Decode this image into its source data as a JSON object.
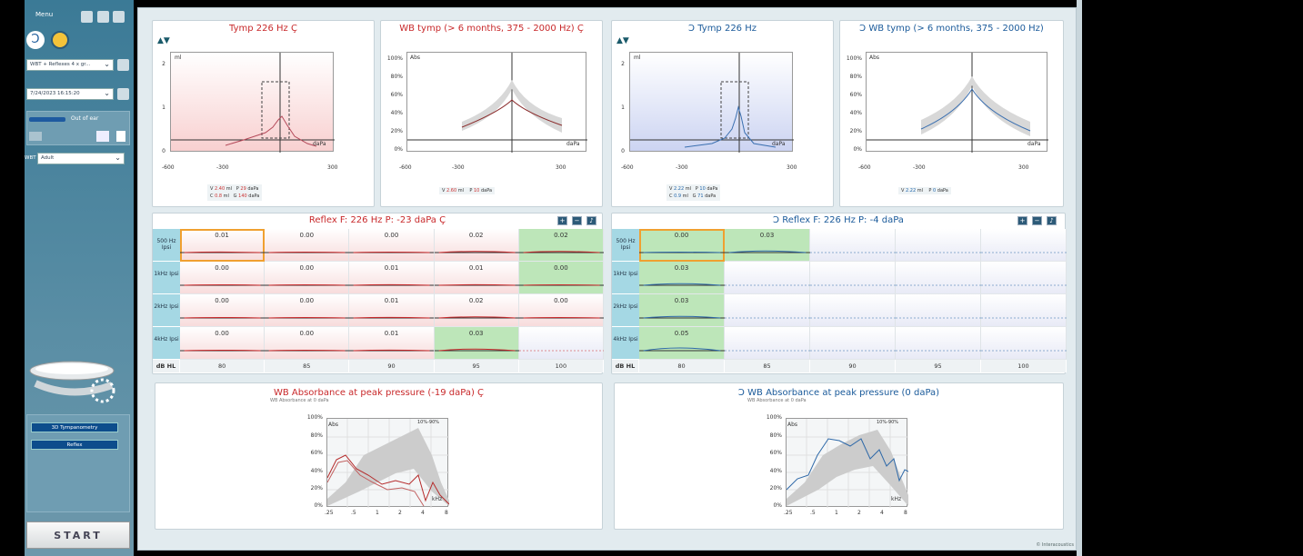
{
  "sidebar": {
    "menu_label": "Menu",
    "protocol": "WBT + Reflexes 4 x gr...",
    "session_date": "7/24/2023 16:15:20",
    "probe_status": "Out of ear",
    "wbt_label": "WBT",
    "wbt_mode": "Adult",
    "tests": [
      {
        "label": "3D Tympanometry"
      },
      {
        "label": "Reflex"
      }
    ],
    "start_label": "START"
  },
  "tymp_left": {
    "title": "Tymp 226 Hz",
    "y_unit": "ml",
    "y_ticks": [
      "2",
      "1",
      "0"
    ],
    "x_unit": "daPa",
    "x_ticks": [
      "-600",
      "-300",
      "300"
    ],
    "vals": {
      "v": "2.40",
      "v_unit": "ml",
      "p": "29",
      "p_unit": "daPa",
      "c": "0.8",
      "c_unit": "ml",
      "g": "140",
      "g_unit": "daPa"
    }
  },
  "wb_left": {
    "title": "WB tymp (> 6 months, 375 - 2000 Hz)",
    "y_unit": "Abs",
    "y_ticks": [
      "100%",
      "80%",
      "60%",
      "40%",
      "20%",
      "0%"
    ],
    "x_unit": "daPa",
    "x_ticks": [
      "-600",
      "-300",
      "300"
    ],
    "vals": {
      "v": "2.60",
      "v_unit": "ml",
      "p": "10",
      "p_unit": "daPa"
    }
  },
  "tymp_right": {
    "title": "Tymp 226 Hz",
    "y_unit": "ml",
    "y_ticks": [
      "2",
      "1",
      "0"
    ],
    "x_unit": "daPa",
    "x_ticks": [
      "-600",
      "-300",
      "300"
    ],
    "vals": {
      "v": "2.22",
      "v_unit": "ml",
      "p": "10",
      "p_unit": "daPa",
      "c": "0.9",
      "c_unit": "ml",
      "g": "71",
      "g_unit": "daPa"
    }
  },
  "wb_right": {
    "title": "WB tymp (> 6 months, 375 - 2000 Hz)",
    "y_unit": "Abs",
    "y_ticks": [
      "100%",
      "80%",
      "60%",
      "40%",
      "20%",
      "0%"
    ],
    "x_unit": "daPa",
    "x_ticks": [
      "-600",
      "-300",
      "300"
    ],
    "vals": {
      "v": "2.22",
      "v_unit": "ml",
      "p": "0",
      "p_unit": "daPa"
    }
  },
  "reflex_left": {
    "title": "Reflex  F: 226 Hz P: -23 daPa",
    "rows": [
      "500 Hz Ipsi",
      "1kHz Ipsi",
      "2kHz Ipsi",
      "4kHz Ipsi"
    ],
    "values": [
      [
        "0.01",
        "0.00",
        "0.00",
        "0.02",
        "0.02"
      ],
      [
        "0.00",
        "0.00",
        "0.01",
        "0.01",
        "0.00"
      ],
      [
        "0.00",
        "0.00",
        "0.01",
        "0.02",
        "0.00"
      ],
      [
        "0.00",
        "0.00",
        "0.01",
        "0.03",
        ""
      ]
    ],
    "unit": "dB HL",
    "levels": [
      "80",
      "85",
      "90",
      "95",
      "100"
    ]
  },
  "reflex_right": {
    "title": "Reflex  F: 226 Hz P: -4 daPa",
    "rows": [
      "500 Hz Ipsi",
      "1kHz Ipsi",
      "2kHz Ipsi",
      "4kHz Ipsi"
    ],
    "values": [
      [
        "0.00",
        "0.03",
        "",
        "",
        ""
      ],
      [
        "0.03",
        "",
        "",
        "",
        ""
      ],
      [
        "0.03",
        "",
        "",
        "",
        ""
      ],
      [
        "0.05",
        "",
        "",
        "",
        ""
      ]
    ],
    "unit": "dB HL",
    "levels": [
      "80",
      "85",
      "90",
      "95",
      "100"
    ]
  },
  "abs_left": {
    "title": "WB Absorbance at peak pressure (-19 daPa)",
    "subtitle": "WB Absorbance at 0 daPa",
    "y_unit": "Abs",
    "y_ticks": [
      "100%",
      "80%",
      "60%",
      "40%",
      "20%",
      "0%"
    ],
    "x_ticks": [
      ".25",
      ".5",
      "1",
      "2",
      "4",
      "8"
    ],
    "x_unit": "kHz",
    "norm": "10%-90%"
  },
  "abs_right": {
    "title": "WB Absorbance at peak pressure (0 daPa)",
    "subtitle": "WB Absorbance at 0 daPa",
    "y_unit": "Abs",
    "y_ticks": [
      "100%",
      "80%",
      "60%",
      "40%",
      "20%",
      "0%"
    ],
    "x_ticks": [
      ".25",
      ".5",
      "1",
      "2",
      "4",
      "8"
    ],
    "x_unit": "kHz",
    "norm": "10%-90%"
  },
  "copyright": "© Interacoustics",
  "colors": {
    "left_ear": "#c8282a",
    "right_ear": "#1a5a9a",
    "highlight": "#bde6b9",
    "selected": "#f0a030"
  }
}
